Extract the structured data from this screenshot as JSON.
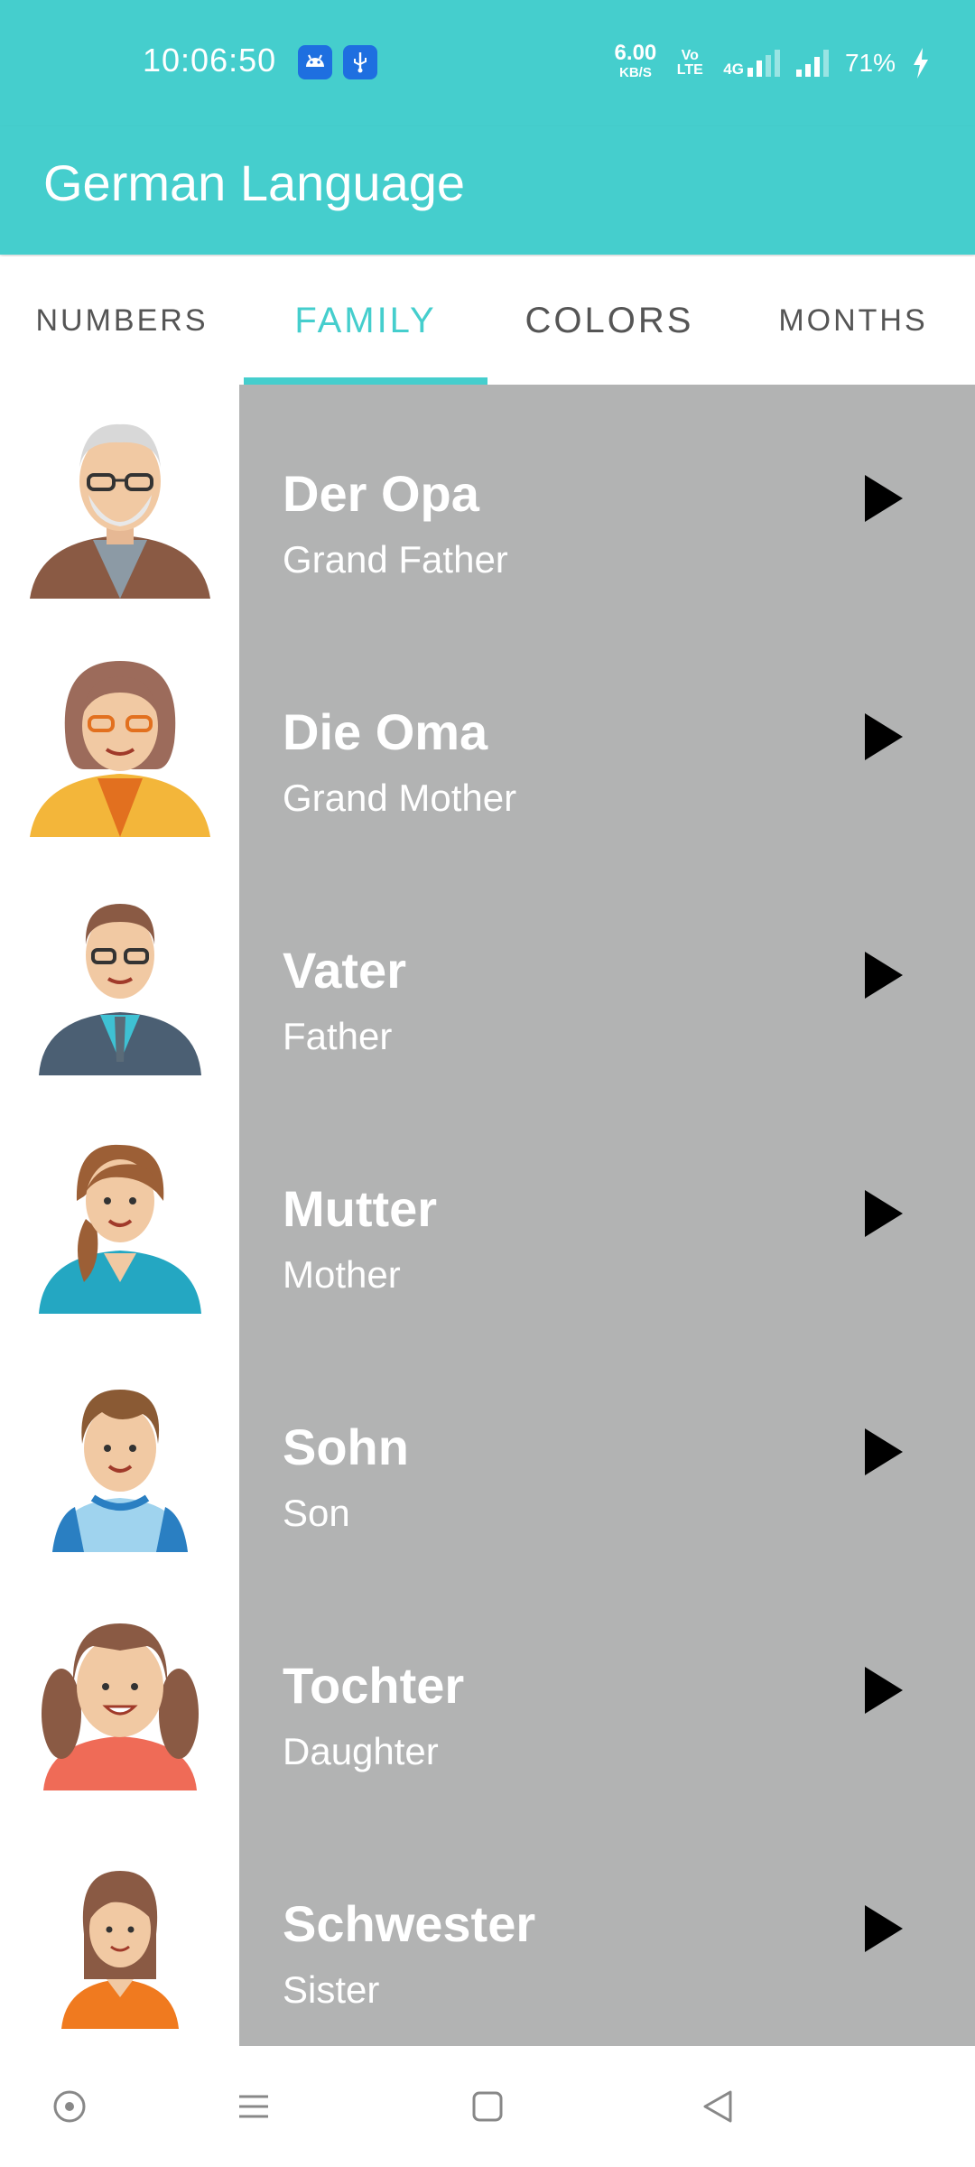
{
  "status_bar": {
    "time": "10:06:50",
    "net_speed_value": "6.00",
    "net_speed_unit": "KB/S",
    "volte_label": "Vo LTE",
    "network_type": "4G",
    "battery_percent": "71%"
  },
  "app_bar": {
    "title": "German Language"
  },
  "tabs": [
    {
      "label": "NUMBERS",
      "active": false
    },
    {
      "label": "FAMILY",
      "active": true
    },
    {
      "label": "COLORS",
      "active": false
    },
    {
      "label": "MONTHS",
      "active": false
    }
  ],
  "words": [
    {
      "german": "Der Opa",
      "english": "Grand Father",
      "avatar": "grandfather-avatar"
    },
    {
      "german": "Die Oma",
      "english": "Grand Mother",
      "avatar": "grandmother-avatar"
    },
    {
      "german": "Vater",
      "english": "Father",
      "avatar": "father-avatar"
    },
    {
      "german": "Mutter",
      "english": "Mother",
      "avatar": "mother-avatar"
    },
    {
      "german": "Sohn",
      "english": "Son",
      "avatar": "son-avatar"
    },
    {
      "german": "Tochter",
      "english": "Daughter",
      "avatar": "daughter-avatar"
    },
    {
      "german": "Schwester",
      "english": "Sister",
      "avatar": "sister-avatar"
    }
  ],
  "colors": {
    "primary": "#45cecd",
    "item_background": "#b2b3b3",
    "text_on_item": "#ffffff"
  }
}
